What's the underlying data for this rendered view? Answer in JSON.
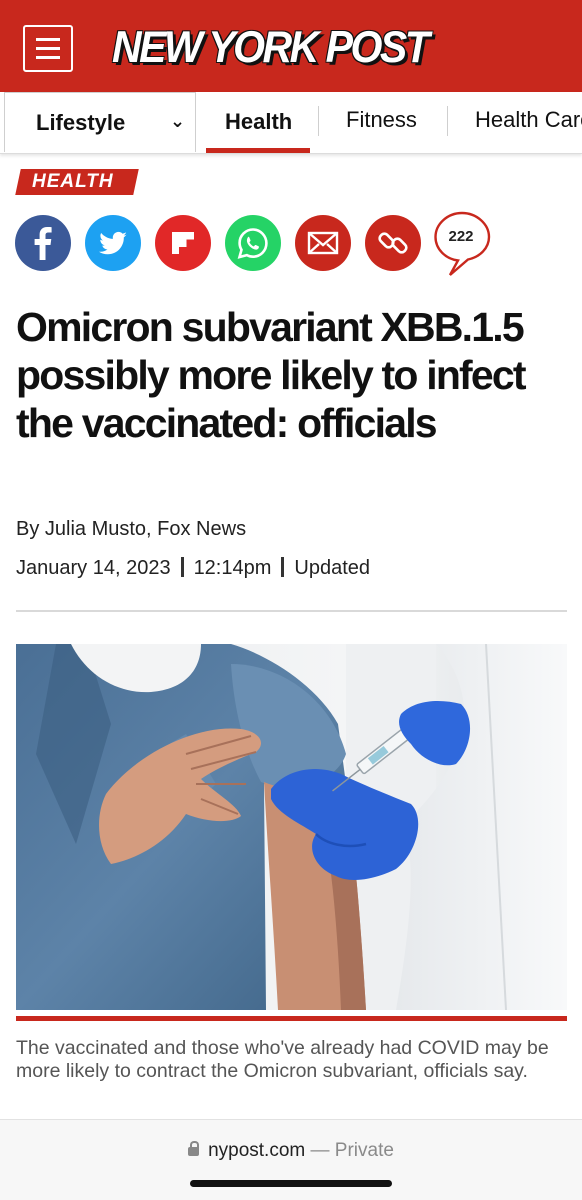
{
  "header": {
    "logo_text": "NEW YORK POST",
    "menu_icon": "hamburger-menu-icon",
    "brand_color": "#c8281d"
  },
  "section_nav": {
    "dropdown_label": "Lifestyle",
    "dropdown_icon": "chevron-down-icon",
    "tabs": [
      {
        "label": "Health",
        "active": true
      },
      {
        "label": "Fitness",
        "active": false
      },
      {
        "label": "Health Care",
        "active": false
      }
    ]
  },
  "article": {
    "section_tag": "HEALTH",
    "share_icons": [
      "facebook-icon",
      "twitter-icon",
      "flipboard-icon",
      "whatsapp-icon",
      "email-icon",
      "copy-link-icon"
    ],
    "share_colors": {
      "facebook": "#3b5998",
      "twitter": "#1da1f2",
      "flipboard": "#e12828",
      "whatsapp": "#25d366",
      "email": "#c8281d",
      "link": "#c8281d"
    },
    "comment_count": "222",
    "headline": "Omicron subvariant XBB.1.5 possibly more likely to infect the vaccinated: officials",
    "byline": "By Julia Musto, Fox News",
    "date": "January 14, 2023",
    "time": "12:14pm",
    "updated_label": "Updated",
    "image_caption": "The vaccinated and those who've already had COVID may be more likely to contract the Omicron subvariant, officials say."
  },
  "browser": {
    "domain": "nypost.com",
    "separator": "—",
    "mode": "Private",
    "lock_icon": "lock-icon"
  }
}
